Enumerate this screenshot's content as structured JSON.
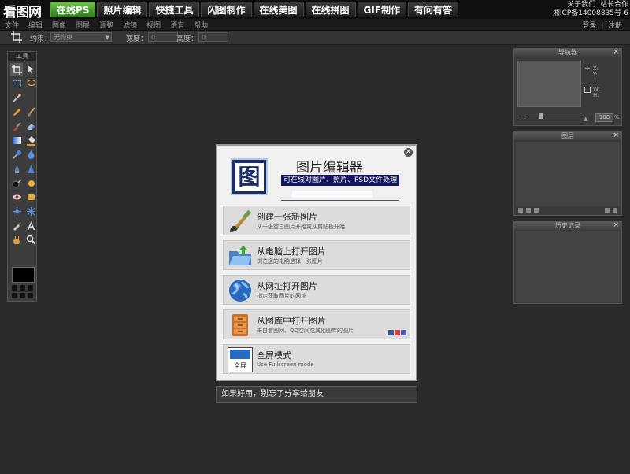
{
  "header": {
    "logo": "看图网",
    "tabs": [
      {
        "label": "在线PS",
        "active": true
      },
      {
        "label": "照片编辑",
        "active": false
      },
      {
        "label": "快捷工具",
        "active": false
      },
      {
        "label": "闪图制作",
        "active": false
      },
      {
        "label": "在线美图",
        "active": false
      },
      {
        "label": "在线拼图",
        "active": false
      },
      {
        "label": "GIF制作",
        "active": false
      },
      {
        "label": "有问有答",
        "active": false
      }
    ],
    "about": "关于我们",
    "partner": "站长合作",
    "icp": "湘ICP备14008835号-6"
  },
  "menubar": {
    "items": [
      "文件",
      "编辑",
      "图像",
      "图层",
      "调整",
      "滤镜",
      "视图",
      "语言",
      "帮助"
    ],
    "login": "登录",
    "separator": "|",
    "register": "注册"
  },
  "optionsbar": {
    "constraint_label": "约束：",
    "constraint_value": "无约束",
    "width_label": "宽度：",
    "width_value": "0",
    "height_label": "高度：",
    "height_value": "0"
  },
  "tools_panel": {
    "title": "工具",
    "tools": [
      "crop-icon",
      "move-icon",
      "marquee-icon",
      "lasso-icon",
      "magic-wand-icon",
      "blank",
      "pencil-icon",
      "brush-icon",
      "clone-stamp-icon",
      "eraser-icon",
      "gradient-icon",
      "paint-bucket-icon",
      "color-replace-icon",
      "blur-icon",
      "spot-heal-icon",
      "sharpen-icon",
      "burn-icon",
      "dodge-icon",
      "red-eye-icon",
      "sponge-icon",
      "bloat-icon",
      "pinch-icon",
      "eyedropper-icon",
      "text-icon",
      "hand-icon",
      "zoom-icon"
    ],
    "foreground_color": "#000000"
  },
  "navigator_panel": {
    "title": "导航器",
    "close": "×",
    "x_label": "X:",
    "y_label": "Y:",
    "w_label": "W:",
    "h_label": "H:",
    "zoom": "100",
    "percent": "%"
  },
  "layers_panel": {
    "title": "图层",
    "close": "×"
  },
  "history_panel": {
    "title": "历史记录",
    "close": "×"
  },
  "dialog": {
    "logo_char": "图",
    "title": "图片编辑器",
    "subtitle": "可在线对图片、照片、PSD文件处理",
    "close": "×",
    "options": [
      {
        "title": "创建一张新图片",
        "desc": "从一张空白图片开始或从剪贴板开始",
        "icon": "paintbrush-icon"
      },
      {
        "title": "从电脑上打开图片",
        "desc": "浏览您的电脑选择一张图片",
        "icon": "folder-open-icon"
      },
      {
        "title": "从网址打开图片",
        "desc": "指定获取图片的网址",
        "icon": "globe-icon"
      },
      {
        "title": "从图库中打开图片",
        "desc": "来自看图网、QQ空间或其他图库的图片",
        "icon": "cabinet-icon"
      },
      {
        "title": "全屏模式",
        "desc": "Use Fullscreen mode",
        "icon": "fullscreen-icon",
        "icon_text": "全屏"
      }
    ]
  },
  "share_bar": {
    "text": "如果好用，别忘了分享给朋友"
  },
  "colors": {
    "accent": "#4ea52e",
    "dialog_bg": "#f0f0f0",
    "subtitle_bg": "#14145e"
  }
}
